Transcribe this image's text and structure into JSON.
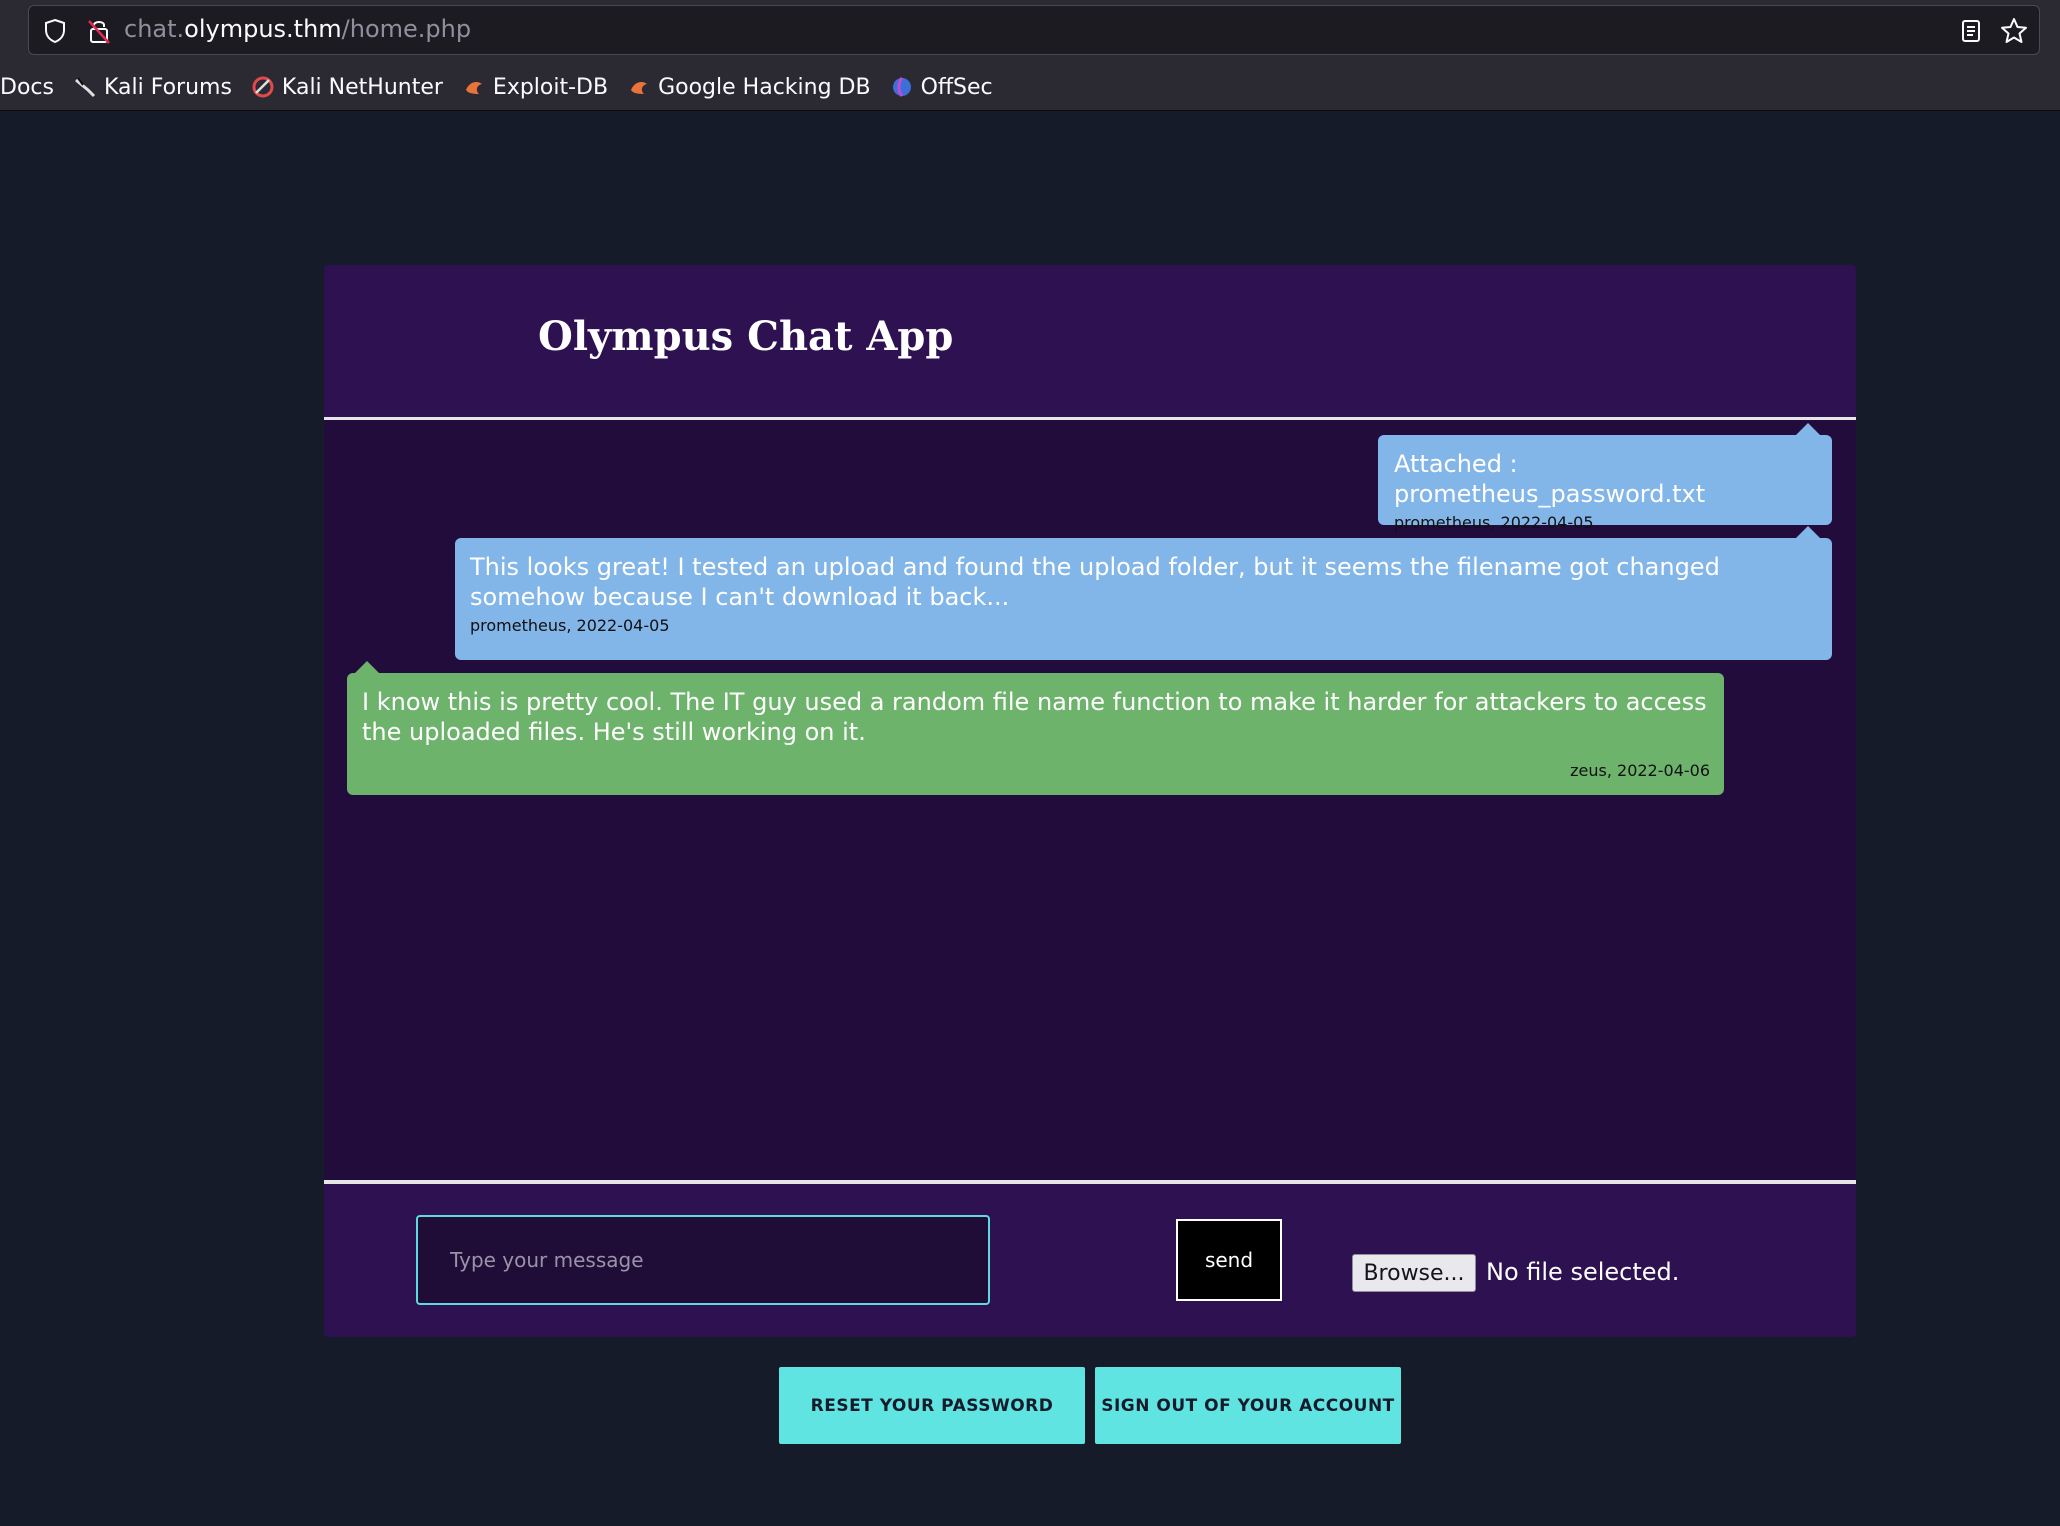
{
  "browser": {
    "url_prefix": "chat.",
    "url_host": "olympus.thm",
    "url_path": "/home.php",
    "bookmarks": [
      {
        "label": "Docs",
        "icon": "none"
      },
      {
        "label": "Kali Forums",
        "icon": "kali-dragon-icon"
      },
      {
        "label": "Kali NetHunter",
        "icon": "nethunter-icon"
      },
      {
        "label": "Exploit-DB",
        "icon": "exploit-db-icon"
      },
      {
        "label": "Google Hacking DB",
        "icon": "ghdb-icon"
      },
      {
        "label": "OffSec",
        "icon": "offsec-icon"
      }
    ]
  },
  "app": {
    "title": "Olympus Chat App"
  },
  "messages": [
    {
      "type": "sent",
      "text": "Attached : prometheus_password.txt",
      "meta": "prometheus, 2022-04-05"
    },
    {
      "type": "sent",
      "text": "This looks great! I tested an upload and found the upload folder, but it seems the filename got changed somehow because I can't download it back...",
      "meta": "prometheus, 2022-04-05"
    },
    {
      "type": "received",
      "text": "I know this is pretty cool. The IT guy used a random file name function to make it harder for attackers to access the uploaded files. He's still working on it.",
      "meta": "zeus, 2022-04-06"
    }
  ],
  "composer": {
    "placeholder": "Type your message",
    "send_label": "send",
    "browse_label": "Browse...",
    "file_status": "No file selected."
  },
  "actions": {
    "reset_label": "RESET YOUR PASSWORD",
    "signout_label": "SIGN OUT OF YOUR ACCOUNT"
  },
  "colors": {
    "page_bg": "#161b29",
    "card_bg": "#2d1150",
    "messages_bg": "#220c3c",
    "sent_bubble": "#82b5e8",
    "received_bubble": "#6db36c",
    "accent": "#5fe4e2"
  }
}
